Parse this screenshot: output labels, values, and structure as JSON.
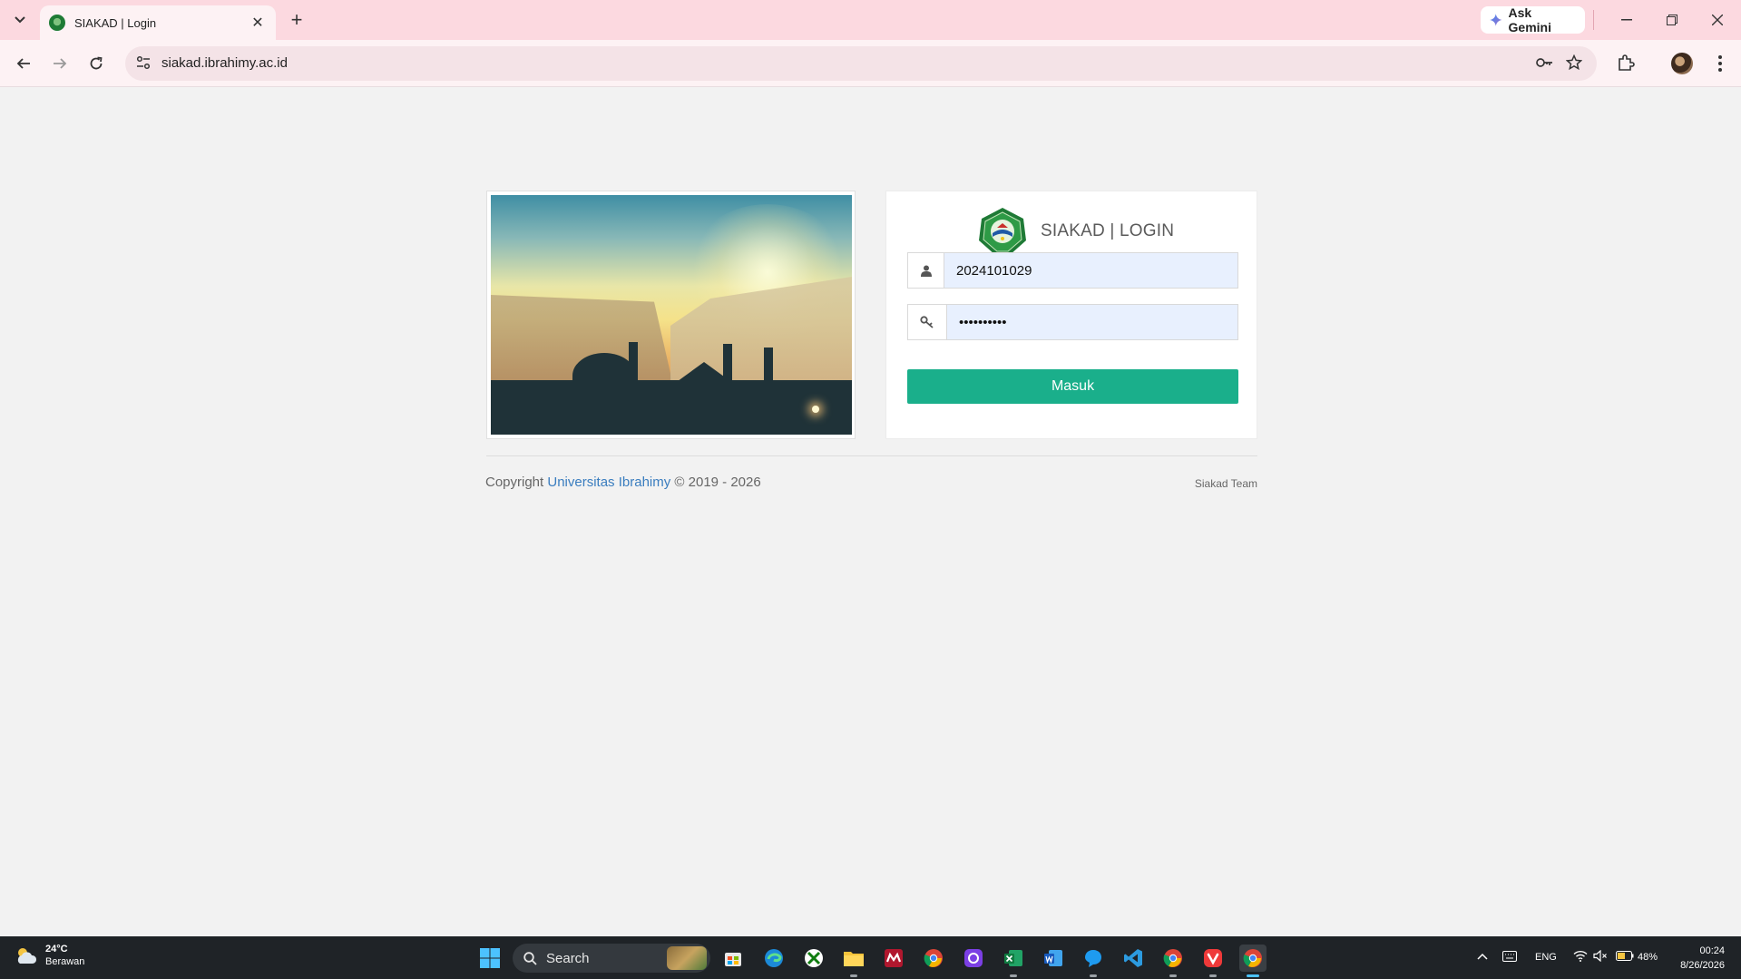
{
  "browser": {
    "tab_title": "SIAKAD | Login",
    "url": "siakad.ibrahimy.ac.id",
    "gemini_label": "Ask Gemini"
  },
  "login": {
    "title": "SIAKAD | LOGIN",
    "username_value": "2024101029",
    "password_value": "••••••••••",
    "submit_label": "Masuk"
  },
  "footer": {
    "copyright_prefix": "Copyright",
    "org_link": "Universitas Ibrahimy",
    "years": "© 2019 - 2026",
    "team": "Siakad Team"
  },
  "taskbar": {
    "weather_temp": "24°C",
    "weather_condition": "Berawan",
    "search_label": "Search",
    "language": "ENG",
    "battery": "48%",
    "time": "00:24",
    "date": "8/26/2026"
  },
  "colors": {
    "accent_button": "#1aaf8b",
    "link": "#3a7dbf",
    "tabstrip": "#fcd9e0"
  }
}
